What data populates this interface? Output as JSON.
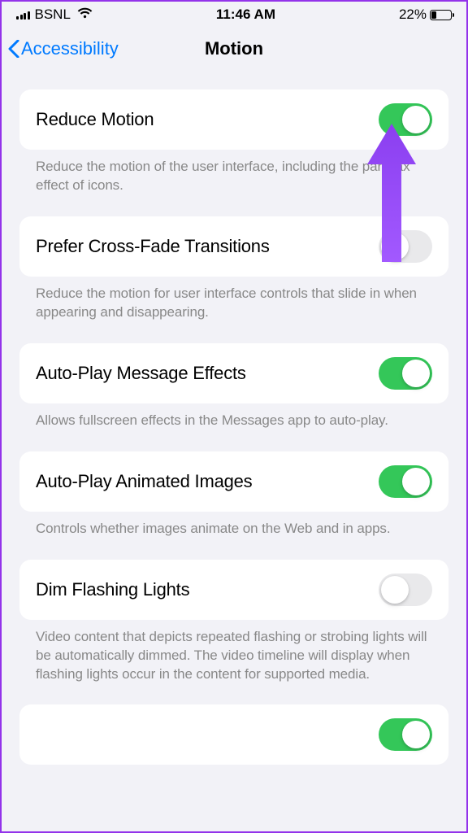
{
  "status": {
    "carrier": "BSNL",
    "time": "11:46 AM",
    "battery_pct": "22%"
  },
  "nav": {
    "back_label": "Accessibility",
    "title": "Motion"
  },
  "sections": [
    {
      "label": "Reduce Motion",
      "enabled": true,
      "footer": "Reduce the motion of the user interface, including the parallax effect of icons."
    },
    {
      "label": "Prefer Cross-Fade Transitions",
      "enabled": false,
      "footer": "Reduce the motion for user interface controls that slide in when appearing and disappearing."
    },
    {
      "label": "Auto-Play Message Effects",
      "enabled": true,
      "footer": "Allows fullscreen effects in the Messages app to auto-play."
    },
    {
      "label": "Auto-Play Animated Images",
      "enabled": true,
      "footer": "Controls whether images animate on the Web and in apps."
    },
    {
      "label": "Dim Flashing Lights",
      "enabled": false,
      "footer": "Video content that depicts repeated flashing or strobing lights will be automatically dimmed. The video timeline will display when flashing lights occur in the content for supported media."
    }
  ]
}
